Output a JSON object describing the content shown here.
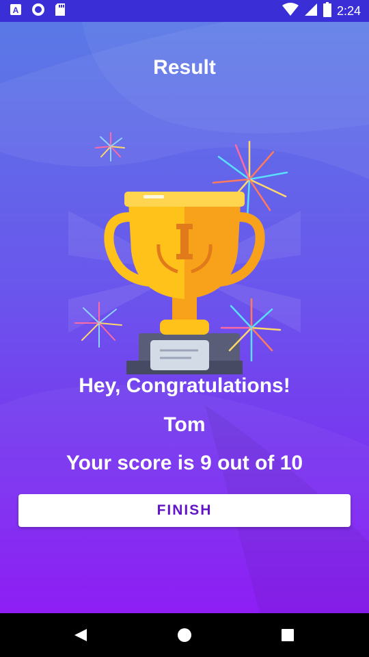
{
  "status_bar": {
    "time": "2:24",
    "left_icons": [
      "a-notification-icon",
      "circle-notification-icon",
      "sd-card-icon"
    ],
    "right_icons": [
      "wifi-icon",
      "cellular-signal-icon",
      "battery-icon"
    ]
  },
  "screen": {
    "title": "Result",
    "congrats_text": "Hey, Congratulations!",
    "user_name": "Tom",
    "score_text": "Your score is 9 out of 10",
    "finish_label": "FINISH",
    "illustration": "trophy-icon"
  },
  "nav_bar": {
    "buttons": [
      "back-icon",
      "home-icon",
      "recents-icon"
    ]
  },
  "colors": {
    "status_bar": "#3a2fd6",
    "gradient_top": "#5a79e6",
    "gradient_bottom": "#8a15f4",
    "button_text": "#6214c9",
    "trophy_gold": "#ffc21a",
    "trophy_orange": "#f7a21a"
  }
}
